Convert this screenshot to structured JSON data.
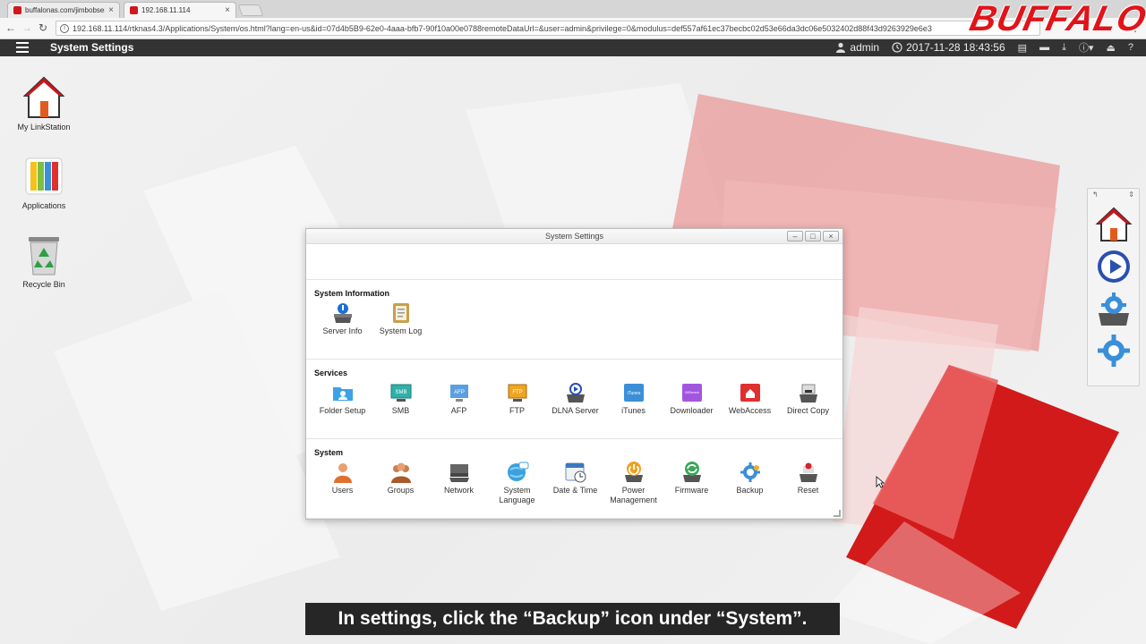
{
  "browser": {
    "tabs": [
      {
        "title": "buffalonas.com/jimbobserv"
      },
      {
        "title": "192.168.11.114"
      }
    ],
    "url": "192.168.11.114/rtknas4.3/Applications/System/os.html?lang=en-us&id=07d4b5B9-62e0-4aaa-bfb7-90f10a00e0788remoteDataUrl=&user=admin&privilege=0&modulus=def557af61ec37becbc02d53e66da3dc06e5032402d88f43d9263929e6e3"
  },
  "brand": {
    "logo_text": "BUFFALO"
  },
  "topbar": {
    "title": "System Settings",
    "user": "admin",
    "datetime": "2017-11-28 18:43:56"
  },
  "desktop_icons": [
    {
      "label": "My LinkStation"
    },
    {
      "label": "Applications"
    },
    {
      "label": "Recycle Bin"
    }
  ],
  "window": {
    "title": "System Settings",
    "sections": [
      {
        "title": "System Information",
        "items": [
          {
            "label": "Server Info",
            "icon": "server-info-icon"
          },
          {
            "label": "System Log",
            "icon": "system-log-icon"
          }
        ]
      },
      {
        "title": "Services",
        "items": [
          {
            "label": "Folder Setup",
            "icon": "folder-setup-icon"
          },
          {
            "label": "SMB",
            "icon": "smb-icon",
            "badge": "SMB"
          },
          {
            "label": "AFP",
            "icon": "afp-icon",
            "badge": "AFP"
          },
          {
            "label": "FTP",
            "icon": "ftp-icon",
            "badge": "FTP"
          },
          {
            "label": "DLNA Server",
            "icon": "dlna-icon"
          },
          {
            "label": "iTunes",
            "icon": "itunes-icon",
            "badge": "iTunes"
          },
          {
            "label": "Downloader",
            "icon": "downloader-icon",
            "badge": "BitTorrent"
          },
          {
            "label": "WebAccess",
            "icon": "webaccess-icon"
          },
          {
            "label": "Direct Copy",
            "icon": "direct-copy-icon"
          }
        ]
      },
      {
        "title": "System",
        "items": [
          {
            "label": "Users",
            "icon": "users-icon"
          },
          {
            "label": "Groups",
            "icon": "groups-icon"
          },
          {
            "label": "Network",
            "icon": "network-icon"
          },
          {
            "label": "System Language",
            "icon": "system-language-icon"
          },
          {
            "label": "Date & Time",
            "icon": "date-time-icon"
          },
          {
            "label": "Power Management",
            "icon": "power-management-icon"
          },
          {
            "label": "Firmware",
            "icon": "firmware-icon"
          },
          {
            "label": "Backup",
            "icon": "backup-icon"
          },
          {
            "label": "Reset",
            "icon": "reset-icon"
          }
        ]
      }
    ]
  },
  "subtitle": "In settings, click the “Backup” icon under “System”.",
  "colors": {
    "brand_red": "#e0141a",
    "topbar": "#333333",
    "accent_blue": "#1a7fd6"
  }
}
